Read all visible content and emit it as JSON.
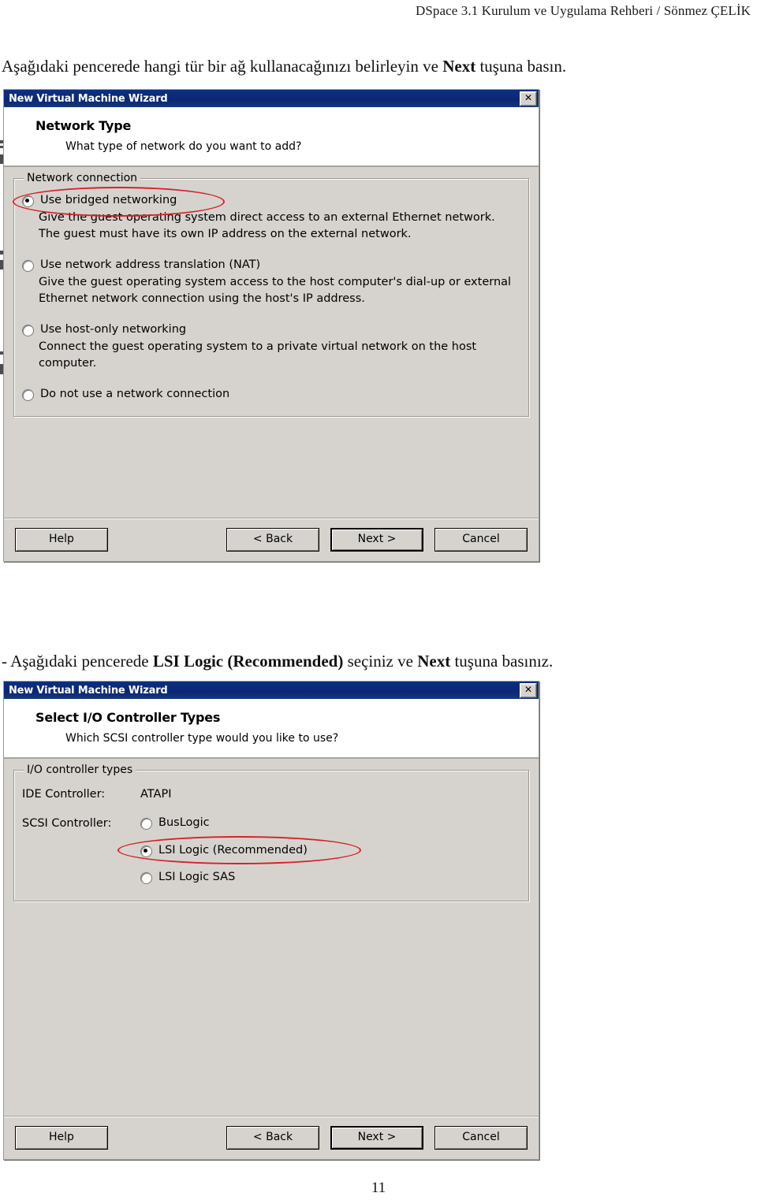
{
  "page": {
    "running_header": "DSpace 3.1  Kurulum ve Uygulama Rehberi / Sönmez ÇELİK",
    "page_number": "11",
    "instruction_1_plain_a": "Aşağıdaki pencerede hangi tür bir ağ kullanacağınızı belirleyin ve ",
    "instruction_1_bold": "Next",
    "instruction_1_plain_b": " tuşuna basın.",
    "instruction_2_plain_a": "- Aşağıdaki pencerede ",
    "instruction_2_bold_a": "LSI Logic (Recommended)",
    "instruction_2_plain_b": " seçiniz ve ",
    "instruction_2_bold_b": "Next",
    "instruction_2_plain_c": " tuşuna basınız."
  },
  "colors": {
    "titlebar": "#0d2f83",
    "dialog_face": "#d6d3ce",
    "highlight_red": "#d8202a"
  },
  "dialog_network": {
    "title": "New Virtual Machine Wizard",
    "close_label": "✕",
    "banner_title": "Network Type",
    "banner_subtitle": "What type of network do you want to add?",
    "group_legend": "Network connection",
    "options": [
      {
        "label": "Use bridged networking",
        "selected": true,
        "highlighted": true,
        "description": "Give the guest operating system direct access to an external Ethernet network. The guest must have its own IP address on the external network."
      },
      {
        "label": "Use network address translation (NAT)",
        "selected": false,
        "highlighted": false,
        "description": "Give the guest operating system access to the host computer's dial-up or external Ethernet network connection using the host's IP address."
      },
      {
        "label": "Use host-only networking",
        "selected": false,
        "highlighted": false,
        "description": "Connect the guest operating system to a private virtual network on the host computer."
      },
      {
        "label": "Do not use a network connection",
        "selected": false,
        "highlighted": false,
        "description": ""
      }
    ],
    "buttons": {
      "help": "Help",
      "back": "< Back",
      "next": "Next >",
      "cancel": "Cancel"
    }
  },
  "dialog_io": {
    "title": "New Virtual Machine Wizard",
    "close_label": "✕",
    "banner_title": "Select I/O Controller Types",
    "banner_subtitle": "Which SCSI controller type would you like to use?",
    "group_legend": "I/O controller types",
    "ide_label": "IDE Controller:",
    "ide_value": "ATAPI",
    "scsi_label": "SCSI Controller:",
    "scsi_options": [
      {
        "label": "BusLogic",
        "selected": false,
        "highlighted": false
      },
      {
        "label": "LSI Logic  (Recommended)",
        "selected": true,
        "highlighted": true
      },
      {
        "label": "LSI Logic SAS",
        "selected": false,
        "highlighted": false
      }
    ],
    "buttons": {
      "help": "Help",
      "back": "< Back",
      "next": "Next >",
      "cancel": "Cancel"
    }
  }
}
